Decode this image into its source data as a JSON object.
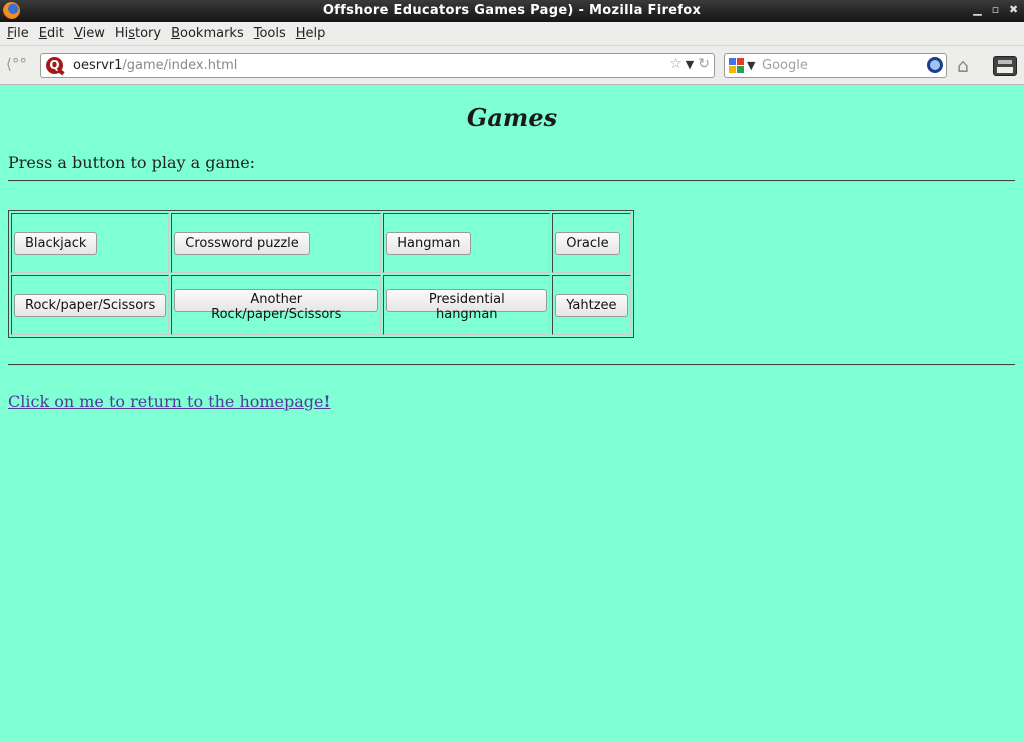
{
  "window": {
    "title": "Offshore Educators Games Page) - Mozilla Firefox",
    "controls": [
      "minimize",
      "maximize",
      "close"
    ]
  },
  "menu": {
    "items": [
      {
        "label": "File",
        "mnemonic": "F"
      },
      {
        "label": "Edit",
        "mnemonic": "E"
      },
      {
        "label": "View",
        "mnemonic": "V"
      },
      {
        "label": "History",
        "mnemonic": "s"
      },
      {
        "label": "Bookmarks",
        "mnemonic": "B"
      },
      {
        "label": "Tools",
        "mnemonic": "T"
      },
      {
        "label": "Help",
        "mnemonic": "H"
      }
    ]
  },
  "navbar": {
    "url_host": "oesrvr1",
    "url_path": "/game/index.html",
    "search_placeholder": "Google",
    "icons": [
      "back-arrow-icon",
      "site-identity-icon",
      "bookmark-star-icon",
      "url-dropdown-icon",
      "reload-icon",
      "search-engine-icon",
      "search-go-icon",
      "home-icon",
      "print-icon"
    ]
  },
  "page": {
    "heading": "Games",
    "intro": "Press a button to play a game:",
    "games": [
      [
        "Blackjack",
        "Crossword puzzle",
        "Hangman",
        "Oracle"
      ],
      [
        "Rock/paper/Scissors",
        "Another Rock/paper/Scissors",
        "Presidential hangman",
        "Yahtzee"
      ]
    ],
    "home_link_text": "Click on me to return to the homepage",
    "home_link_suffix": "!"
  },
  "colors": {
    "page_background": "#7fffd4",
    "link_visited": "#55389a",
    "titlebar": "#1e1e1e"
  }
}
